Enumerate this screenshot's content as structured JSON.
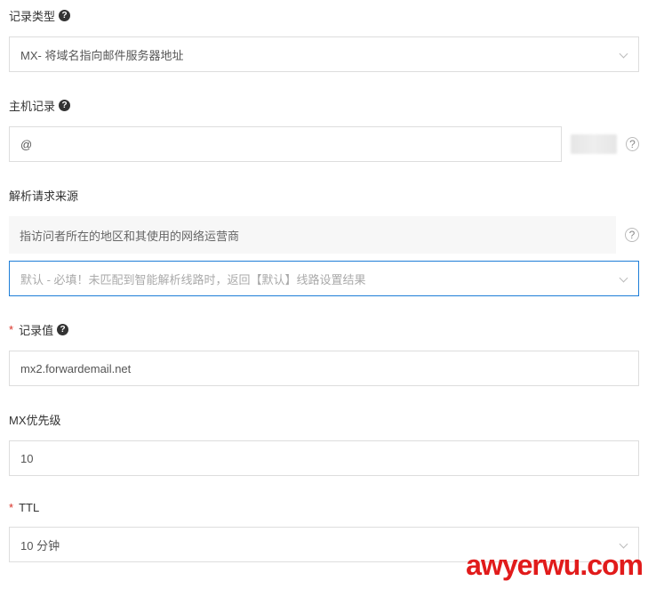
{
  "recordType": {
    "label": "记录类型",
    "value": "MX- 将域名指向邮件服务器地址"
  },
  "hostRecord": {
    "label": "主机记录",
    "value": "@"
  },
  "resolveSource": {
    "label": "解析请求来源",
    "hint": "指访问者所在的地区和其使用的网络运营商",
    "value": "默认 - 必填！未匹配到智能解析线路时，返回【默认】线路设置结果"
  },
  "recordValue": {
    "label": "记录值",
    "value": "mx2.forwardemail.net"
  },
  "mxPriority": {
    "label": "MX优先级",
    "value": "10"
  },
  "ttl": {
    "label": "TTL",
    "value": "10 分钟"
  },
  "watermark": "awyerwu.com"
}
